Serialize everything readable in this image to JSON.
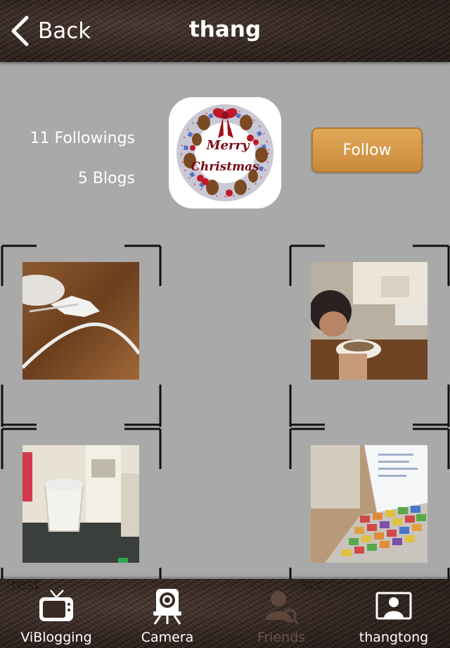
{
  "header": {
    "back_label": "Back",
    "title": "thang"
  },
  "profile": {
    "followings": "11 Followings",
    "blogs": "5 Blogs",
    "avatar_text_line1": "Merry",
    "avatar_text_line2": "Christmas",
    "follow_label": "Follow"
  },
  "ghost_labels": {
    "left": "test",
    "right": "scc"
  },
  "tabs": [
    {
      "label": "ViBlogging",
      "icon": "tv-icon"
    },
    {
      "label": "Camera",
      "icon": "camera-icon"
    },
    {
      "label": "Friends",
      "icon": "friends-icon"
    },
    {
      "label": "thangtong",
      "icon": "profile-icon"
    }
  ],
  "colors": {
    "follow": "#d49a4c",
    "background": "#a9a9a9",
    "bar": "#2e211c"
  }
}
